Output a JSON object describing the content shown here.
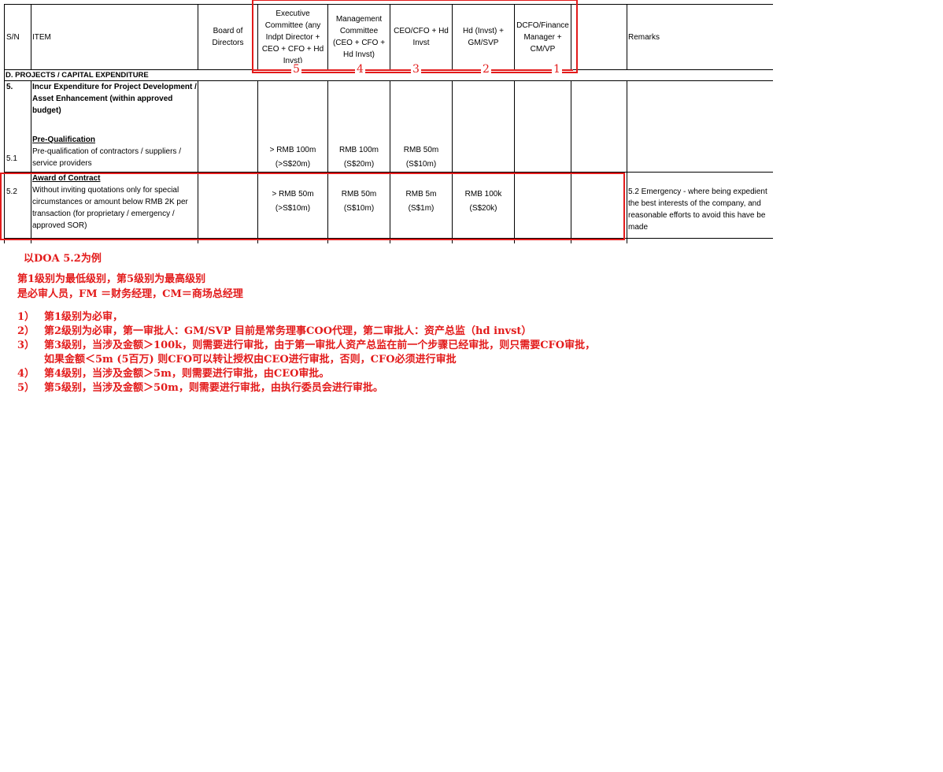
{
  "headers": {
    "sn": "S/N",
    "item": "ITEM",
    "board": "Board of Directors",
    "exco": "Executive Committee (any Indpt Director + CEO + CFO + Hd Invst)",
    "mgmt": "Management Committee (CEO + CFO + Hd Invst)",
    "ceo": "CEO/CFO + Hd Invst",
    "hd": "Hd (Invst) + GM/SVP",
    "dcfo": "DCFO/Finance Manager + CM/VP",
    "blank": "",
    "remarks": "Remarks"
  },
  "section": {
    "title": "D. PROJECTS / CAPITAL EXPENDITURE"
  },
  "rows": {
    "r5": {
      "sn": "5.",
      "title": "Incur Expenditure for Project Development / Asset Enhancement (within approved budget)",
      "sn_sub": "5.1",
      "sub_title": "Pre-Qualification",
      "sub_desc": "Pre-qualification of contractors / suppliers / service providers",
      "exco_1": "> RMB 100m",
      "exco_2": "(>S$20m)",
      "mgmt_1": "RMB 100m",
      "mgmt_2": "(S$20m)",
      "ceo_1": "RMB 50m",
      "ceo_2": "(S$10m)"
    },
    "r52": {
      "sn": "5.2",
      "title": "Award of Contract",
      "desc": "Without inviting quotations only for special circumstances or amount below RMB 2K per transaction (for proprietary / emergency / approved SOR)",
      "exco_1": "> RMB 50m",
      "exco_2": "(>S$10m)",
      "mgmt_1": "RMB 50m",
      "mgmt_2": "(S$10m)",
      "ceo_1": "RMB 5m",
      "ceo_2": "(S$1m)",
      "hd_1": "RMB 100k",
      "hd_2": "(S$20k)",
      "remark_1": "5.2 Emergency - where being expedient",
      "remark_2": "the best interests of the company, and",
      "remark_3": "reasonable efforts to avoid this have be",
      "remark_4": "made"
    }
  },
  "levels": [
    "5",
    "4",
    "3",
    "2",
    "1"
  ],
  "notes": {
    "example": "以DOA 5.2为例",
    "line1": "第1级别为最低级别，第5级别为最高级别",
    "line2": "是必审人员，FM ＝财务经理，CM＝商场总经理",
    "items": [
      {
        "num": "1）",
        "text": "第1级别为必审，"
      },
      {
        "num": "2）",
        "text": "第2级别为必审，第一审批人：GM/SVP 目前是常务理事COO代理，第二审批人：资产总监（hd invst）"
      },
      {
        "num": "3）",
        "text": "第3级别，当涉及金额＞100k，则需要进行审批，由于第一审批人资产总监在前一个步骤已经审批，则只需要CFO审批，",
        "cont": "如果金额＜5m (5百万) 则CFO可以转让授权由CEO进行审批，否则，CFO必须进行审批"
      },
      {
        "num": "4）",
        "text": "第4级别，当涉及金额＞5m，则需要进行审批，由CEO审批。"
      },
      {
        "num": "5）",
        "text": "第5级别，当涉及金额＞50m，则需要进行审批，由执行委员会进行审批。"
      }
    ]
  },
  "colors": {
    "annotation": "#e31b1b"
  }
}
